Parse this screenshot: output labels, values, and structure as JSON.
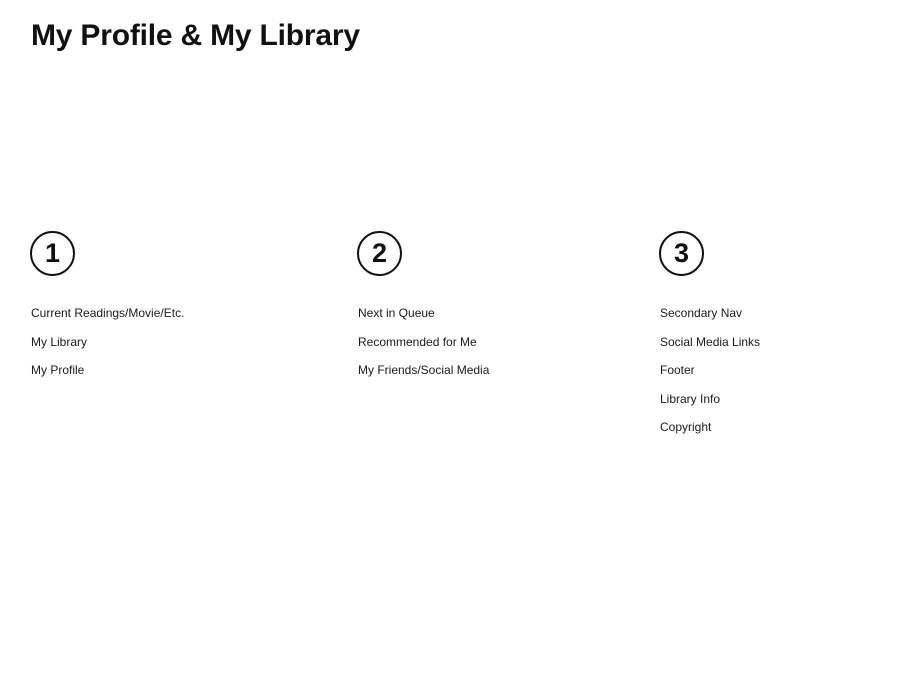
{
  "title": "My Profile & My Library",
  "sections": [
    {
      "number": "1",
      "items": [
        "Current Readings/Movie/Etc.",
        "My Library",
        "My Profile"
      ]
    },
    {
      "number": "2",
      "items": [
        "Next in Queue",
        "Recommended for Me",
        "My Friends/Social Media"
      ]
    },
    {
      "number": "3",
      "items": [
        "Secondary Nav",
        "Social Media Links",
        "Footer",
        "Library Info",
        "Copyright"
      ]
    }
  ]
}
